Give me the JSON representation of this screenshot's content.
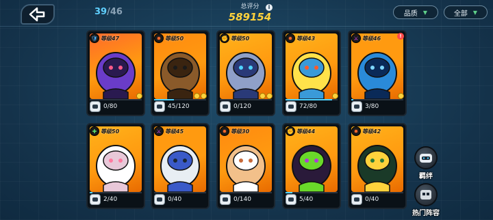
{
  "header": {
    "collection_current": "39",
    "collection_total": "/46",
    "score_label": "总评分",
    "score_value": "589154",
    "filter_quality": "品质",
    "filter_all": "全部"
  },
  "level_prefix": "等级",
  "cards": [
    {
      "level": "47",
      "progress": "0/80",
      "fill": 0.0,
      "bg": "#ff6a2a",
      "element": "shield-icon",
      "stars": 1,
      "alert": false
    },
    {
      "level": "50",
      "progress": "45/120",
      "fill": 0.375,
      "bg": "#ff8a10",
      "element": "flame-icon",
      "stars": 2,
      "alert": false
    },
    {
      "level": "50",
      "progress": "0/120",
      "fill": 0.0,
      "bg": "#ffb21a",
      "element": "fist-icon",
      "stars": 2,
      "alert": false
    },
    {
      "level": "43",
      "progress": "72/80",
      "fill": 0.9,
      "bg": "#ffb21a",
      "element": "flame-icon",
      "stars": 1,
      "alert": false
    },
    {
      "level": "46",
      "progress": "3/80",
      "fill": 0.0375,
      "bg": "#ff9a10",
      "element": "sword-icon",
      "stars": 1,
      "alert": true
    },
    {
      "level": "50",
      "progress": "2/40",
      "fill": 0.05,
      "bg": "#ffb21a",
      "element": "cross-icon",
      "stars": 0,
      "alert": false
    },
    {
      "level": "45",
      "progress": "0/40",
      "fill": 0.0,
      "bg": "#ff9a10",
      "element": "sword-icon",
      "stars": 0,
      "alert": false
    },
    {
      "level": "30",
      "progress": "0/140",
      "fill": 0.0,
      "bg": "#ff8a10",
      "element": "flame-icon",
      "stars": 0,
      "alert": false
    },
    {
      "level": "44",
      "progress": "5/40",
      "fill": 0.125,
      "bg": "#ffb21a",
      "element": "fist-icon",
      "stars": 0,
      "alert": false
    },
    {
      "level": "42",
      "progress": "0/40",
      "fill": 0.0,
      "bg": "#ffb21a",
      "element": "flame-icon",
      "stars": 0,
      "alert": false
    }
  ],
  "side": {
    "bond_label": "羁绊",
    "lineup_label": "热门阵容"
  },
  "colors": {
    "accent_count": "#5fd0ff",
    "score": "#ffd23c"
  }
}
